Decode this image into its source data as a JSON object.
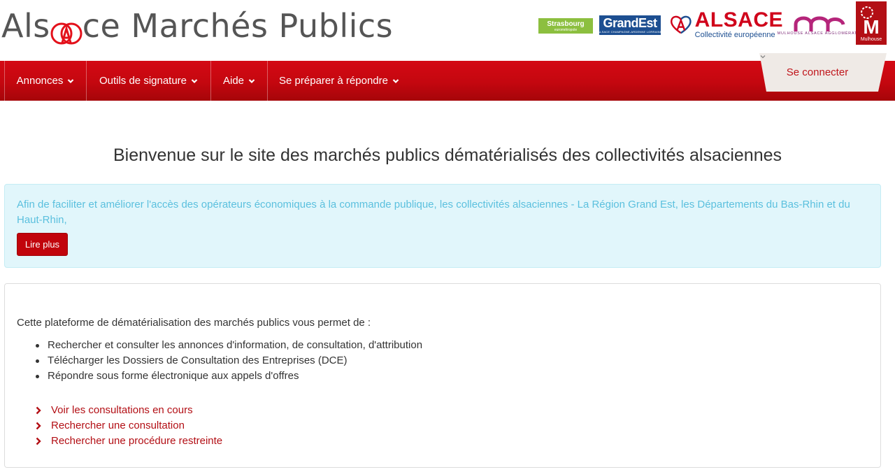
{
  "header": {
    "site_title_part1": "Als",
    "site_title_part2": "ce Marchés Publics",
    "title_mark_icon": "red-circle-a-mark-icon",
    "logos": {
      "strasbourg": {
        "name": "Strasbourg",
        "sub": "eurométropole"
      },
      "grandest": {
        "name": "GrandEst",
        "sub": "ALSACE CHAMPAGNE-ARDENNE LORRAINE"
      },
      "alsace": {
        "name": "ALSACE",
        "sub": "Collectivité européenne"
      },
      "mulhouse_agglo": {
        "name": "MULHOUSE ALSACE AGGLOMÉRATION"
      },
      "mulhouse": {
        "letter": "M",
        "name": "Mulhouse"
      }
    }
  },
  "nav": {
    "items": [
      {
        "label": "Annonces",
        "icon": "chevron-down-icon"
      },
      {
        "label": "Outils de signature",
        "icon": "chevron-down-icon"
      },
      {
        "label": "Aide",
        "icon": "chevron-down-icon"
      },
      {
        "label": "Se préparer à répondre",
        "icon": "chevron-down-icon"
      }
    ],
    "connect_label": "Se connecter"
  },
  "main": {
    "welcome": "Bienvenue sur le site des marchés publics dématérialisés des collectivités alsaciennes",
    "alert_text": "Afin de faciliter et améliorer l'accès des opérateurs économiques à la commande publique, les collectivités alsaciennes - La Région Grand Est, les Départements du Bas-Rhin et du Haut-Rhin,",
    "read_more_label": "Lire plus",
    "intro": "Cette plateforme de dématérialisation des marchés publics vous permet de :",
    "bullets": [
      "Rechercher et consulter les annonces d'information, de consultation, d'attribution",
      "Télécharger les Dossiers de Consultation des Entreprises (DCE)",
      "Répondre sous forme électronique aux appels d'offres"
    ],
    "links": [
      "Voir les consultations en cours",
      "Rechercher une consultation",
      "Rechercher une procédure restreinte"
    ]
  },
  "colors": {
    "brand_red": "#c4070f",
    "link_red": "#b30f15",
    "alert_bg": "#e1f6fb",
    "alert_text": "#5bc0de"
  }
}
